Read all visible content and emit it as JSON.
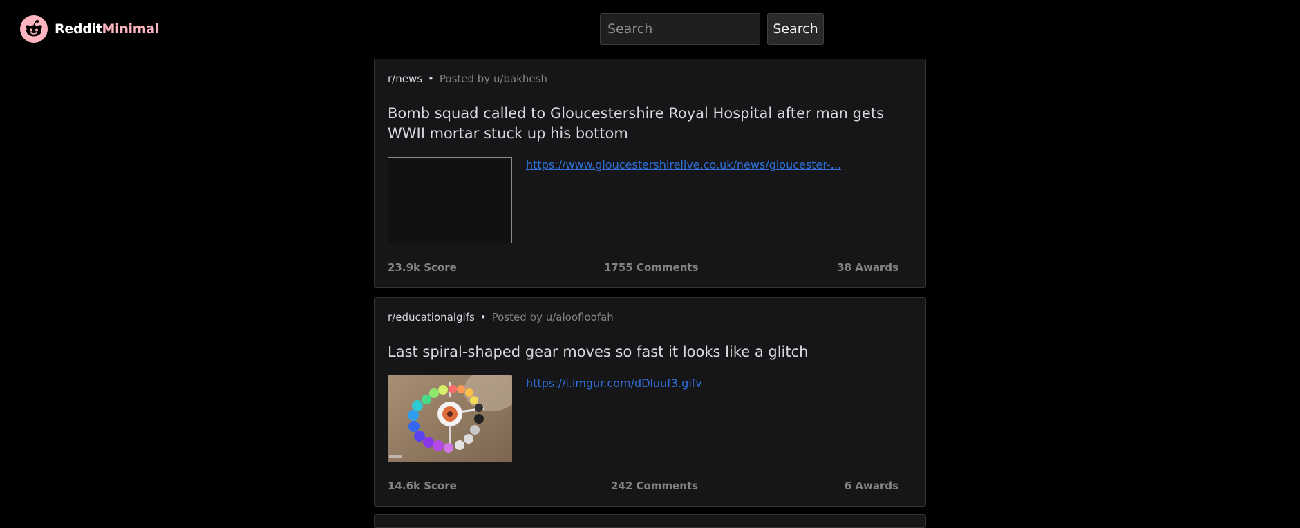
{
  "header": {
    "logo_icon": "reddit-alien-icon",
    "logo_word1": "Reddit",
    "logo_word2": "Minimal",
    "search_placeholder": "Search",
    "search_button_label": "Search",
    "accent_color": "#ffb6c1"
  },
  "posts": [
    {
      "subreddit": "r/news",
      "separator": "•",
      "posted_by": "Posted by u/bakhesh",
      "title": "Bomb squad called to Gloucestershire Royal Hospital after man gets WWII mortar stuck up his bottom",
      "link": "https://www.gloucestershirelive.co.uk/news/gloucester-...",
      "thumbnail": "empty-thumbnail",
      "score": "23.9k Score",
      "comments": "1755 Comments",
      "awards": "38 Awards"
    },
    {
      "subreddit": "r/educationalgifs",
      "separator": "•",
      "posted_by": "Posted by u/aloofloofah",
      "title": "Last spiral-shaped gear moves so fast it looks like a glitch",
      "link": "https://i.imgur.com/dDluuf3.gifv",
      "thumbnail": "spiral-gear-image",
      "score": "14.6k Score",
      "comments": "242 Comments",
      "awards": "6 Awards"
    }
  ]
}
